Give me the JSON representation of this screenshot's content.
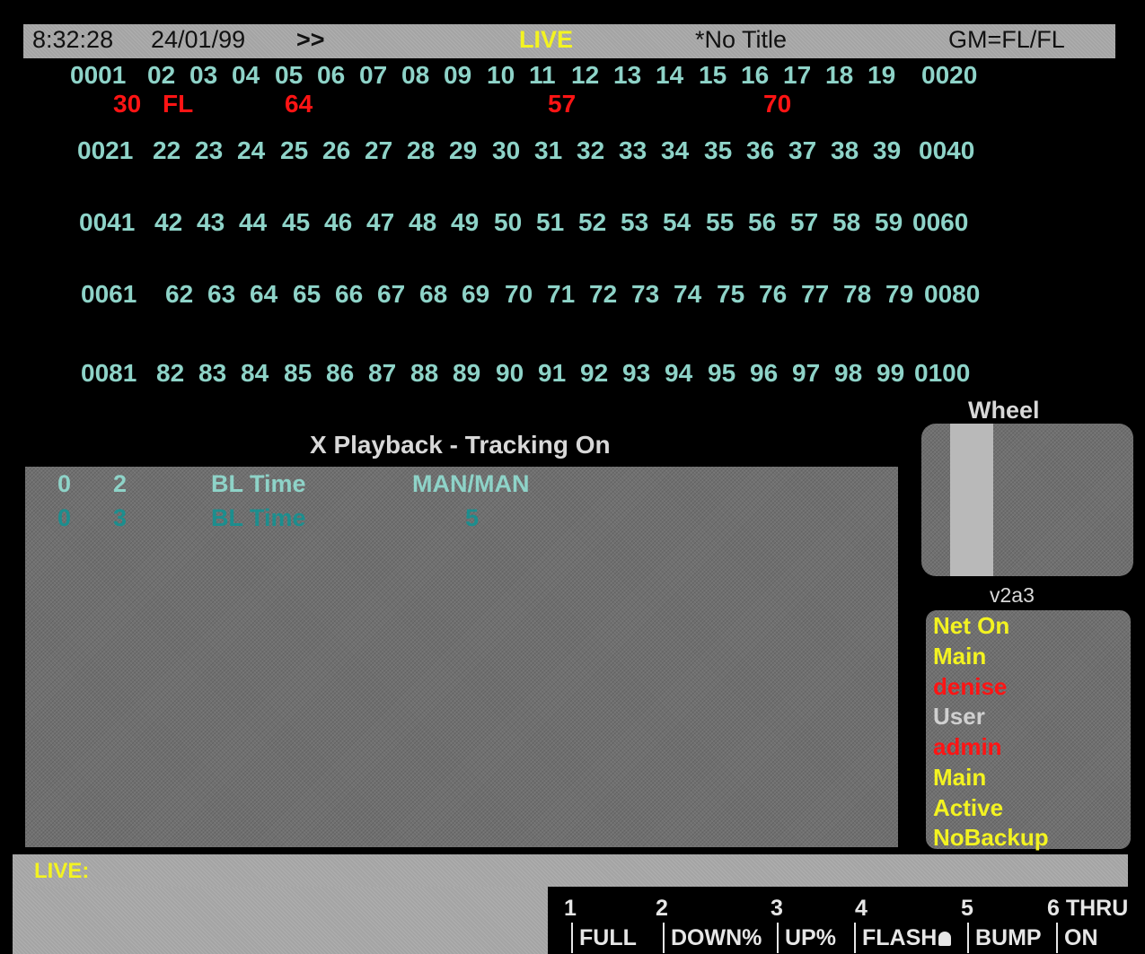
{
  "header": {
    "clock": "8:32:28",
    "date": "24/01/99",
    "arrows": ">>",
    "mode": "LIVE",
    "title": "*No Title",
    "gm": "GM=FL/FL"
  },
  "channels": {
    "row1": [
      "0001",
      "02",
      "03",
      "04",
      "05",
      "06",
      "07",
      "08",
      "09",
      "10",
      "11",
      "12",
      "13",
      "14",
      "15",
      "16",
      "17",
      "18",
      "19",
      "0020"
    ],
    "row1_levels": [
      "30",
      "FL",
      "64",
      "57",
      "70"
    ],
    "row2": [
      "0021",
      "22",
      "23",
      "24",
      "25",
      "26",
      "27",
      "28",
      "29",
      "30",
      "31",
      "32",
      "33",
      "34",
      "35",
      "36",
      "37",
      "38",
      "39",
      "0040"
    ],
    "row3": [
      "0041",
      "42",
      "43",
      "44",
      "45",
      "46",
      "47",
      "48",
      "49",
      "50",
      "51",
      "52",
      "53",
      "54",
      "55",
      "56",
      "57",
      "58",
      "59",
      "0060"
    ],
    "row4": [
      "0061",
      "62",
      "63",
      "64",
      "65",
      "66",
      "67",
      "68",
      "69",
      "70",
      "71",
      "72",
      "73",
      "74",
      "75",
      "76",
      "77",
      "78",
      "79",
      "0080"
    ],
    "row5": [
      "0081",
      "82",
      "83",
      "84",
      "85",
      "86",
      "87",
      "88",
      "89",
      "90",
      "91",
      "92",
      "93",
      "94",
      "95",
      "96",
      "97",
      "98",
      "99",
      "0100"
    ]
  },
  "playback": {
    "title": "X Playback - Tracking On",
    "rows": [
      {
        "a": "0",
        "b": "2",
        "c": "BL Time",
        "d": "MAN/MAN"
      },
      {
        "a": "0",
        "b": "3",
        "c": "BL Time",
        "d": "5"
      }
    ]
  },
  "wheel": {
    "label": "Wheel",
    "version": "v2a3"
  },
  "info": [
    {
      "text": "Net On",
      "color": "#f3f321"
    },
    {
      "text": "Main",
      "color": "#f3f321"
    },
    {
      "text": "denise",
      "color": "#ff1414"
    },
    {
      "text": "User",
      "color": "#d0d0d0"
    },
    {
      "text": "admin",
      "color": "#ff1414"
    },
    {
      "text": "Main",
      "color": "#f3f321"
    },
    {
      "text": "Active",
      "color": "#f3f321"
    },
    {
      "text": "NoBackup",
      "color": "#f3f321"
    }
  ],
  "command_line": {
    "label": "LIVE:"
  },
  "softkeys": [
    {
      "num": "1",
      "label": "FULL"
    },
    {
      "num": "2",
      "label": "DOWN%"
    },
    {
      "num": "3",
      "label": "UP%"
    },
    {
      "num": "4",
      "label": "FLASH"
    },
    {
      "num": "5",
      "label": "BUMP"
    },
    {
      "num": "6 THRU",
      "label": "ON"
    }
  ]
}
